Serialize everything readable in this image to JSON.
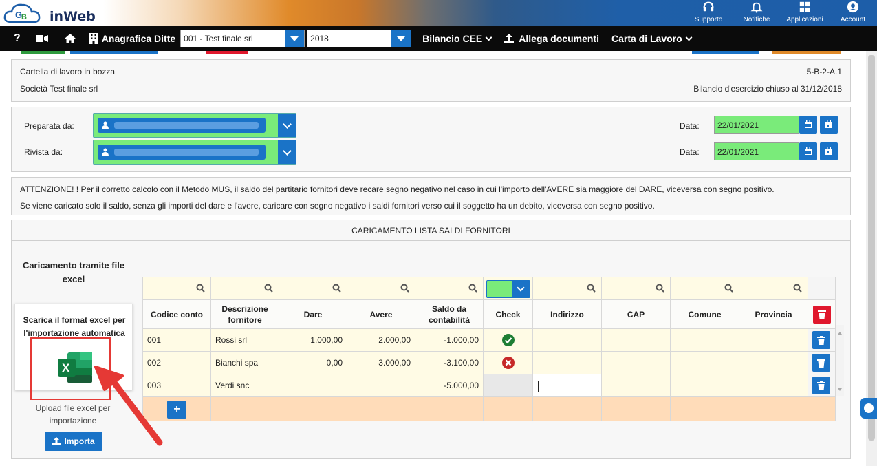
{
  "brand": {
    "logo_text": "inWeb"
  },
  "top_actions": [
    {
      "label": "Supporto",
      "icon": "headset-icon"
    },
    {
      "label": "Notifiche",
      "icon": "bell-icon"
    },
    {
      "label": "Applicazioni",
      "icon": "grid-icon"
    },
    {
      "label": "Account",
      "icon": "user-circle-icon"
    }
  ],
  "navbar": {
    "help": "?",
    "anagrafica_label": "Anagrafica Ditte",
    "company_select": "001 - Test finale srl",
    "year_select": "2018",
    "bilancio_label": "Bilancio CEE",
    "allega_label": "Allega documenti",
    "carta_label": "Carta di Lavoro"
  },
  "header": {
    "status": "Cartella di lavoro in bozza",
    "company": "Società Test finale srl",
    "code": "5-B-2-A.1",
    "fiscal_year": "Bilancio d'esercizio chiuso al 31/12/2018"
  },
  "prepared": {
    "prepared_label": "Preparata da:",
    "reviewed_label": "Rivista da:",
    "date_label": "Data:",
    "prepared_date": "22/01/2021",
    "reviewed_date": "22/01/2021"
  },
  "warning": {
    "line1": "ATTENZIONE! ! Per il corretto calcolo con il Metodo MUS, il saldo del partitario fornitori deve recare segno negativo nel caso in cui l'importo dell'AVERE sia maggiore del DARE, viceversa con segno positivo.",
    "line2": "Se viene caricato solo il saldo, senza gli importi del dare e l'avere, caricare con segno negativo i saldi fornitori verso cui il soggetto ha un debito, viceversa con segno positivo."
  },
  "main": {
    "title": "CARICAMENTO LISTA SALDI FORNITORI",
    "excel_title": "Caricamento tramite file excel",
    "excel_card_text": "Scarica il format excel per l'importazione automatica",
    "upload_text": "Upload file excel per importazione",
    "import_button": "Importa"
  },
  "table": {
    "headers": [
      "Codice conto",
      "Descrizione fornitore",
      "Dare",
      "Avere",
      "Saldo da contabilità",
      "Check",
      "Indirizzo",
      "CAP",
      "Comune",
      "Provincia"
    ],
    "rows": [
      {
        "codice": "001",
        "descrizione": "Rossi srl",
        "dare": "1.000,00",
        "avere": "2.000,00",
        "saldo": "-1.000,00",
        "check": "ok"
      },
      {
        "codice": "002",
        "descrizione": "Bianchi spa",
        "dare": "0,00",
        "avere": "3.000,00",
        "saldo": "-3.100,00",
        "check": "error"
      },
      {
        "codice": "003",
        "descrizione": "Verdi snc",
        "dare": "",
        "avere": "",
        "saldo": "-5.000,00",
        "check": ""
      }
    ],
    "add_button": "+"
  },
  "colors": {
    "accent": "#1a73c7",
    "green_field": "#7aeb7a",
    "row_yellow": "#fffbe5",
    "footer_peach": "#ffdcb9",
    "danger": "#e0182d",
    "highlight_red": "#e53935"
  }
}
